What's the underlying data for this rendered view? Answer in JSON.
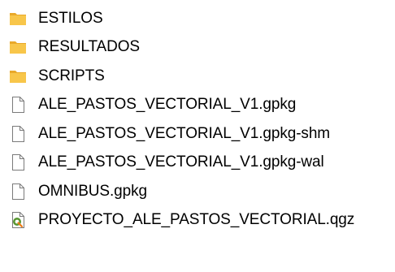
{
  "colors": {
    "folder": "#f8c64a",
    "folder_dark": "#e9a92a",
    "file_outline": "#7a7a7a",
    "qgz_green": "#589632",
    "qgz_yellow": "#ee7913"
  },
  "files": [
    {
      "name": "ESTILOS",
      "type": "folder",
      "icon": "folder-icon"
    },
    {
      "name": "RESULTADOS",
      "type": "folder",
      "icon": "folder-icon"
    },
    {
      "name": "SCRIPTS",
      "type": "folder",
      "icon": "folder-icon"
    },
    {
      "name": "ALE_PASTOS_VECTORIAL_V1.gpkg",
      "type": "file",
      "icon": "document-icon"
    },
    {
      "name": "ALE_PASTOS_VECTORIAL_V1.gpkg-shm",
      "type": "file",
      "icon": "document-icon"
    },
    {
      "name": "ALE_PASTOS_VECTORIAL_V1.gpkg-wal",
      "type": "file",
      "icon": "document-icon"
    },
    {
      "name": "OMNIBUS.gpkg",
      "type": "file",
      "icon": "document-icon"
    },
    {
      "name": "PROYECTO_ALE_PASTOS_VECTORIAL.qgz",
      "type": "qgis-project",
      "icon": "qgis-project-icon"
    }
  ]
}
